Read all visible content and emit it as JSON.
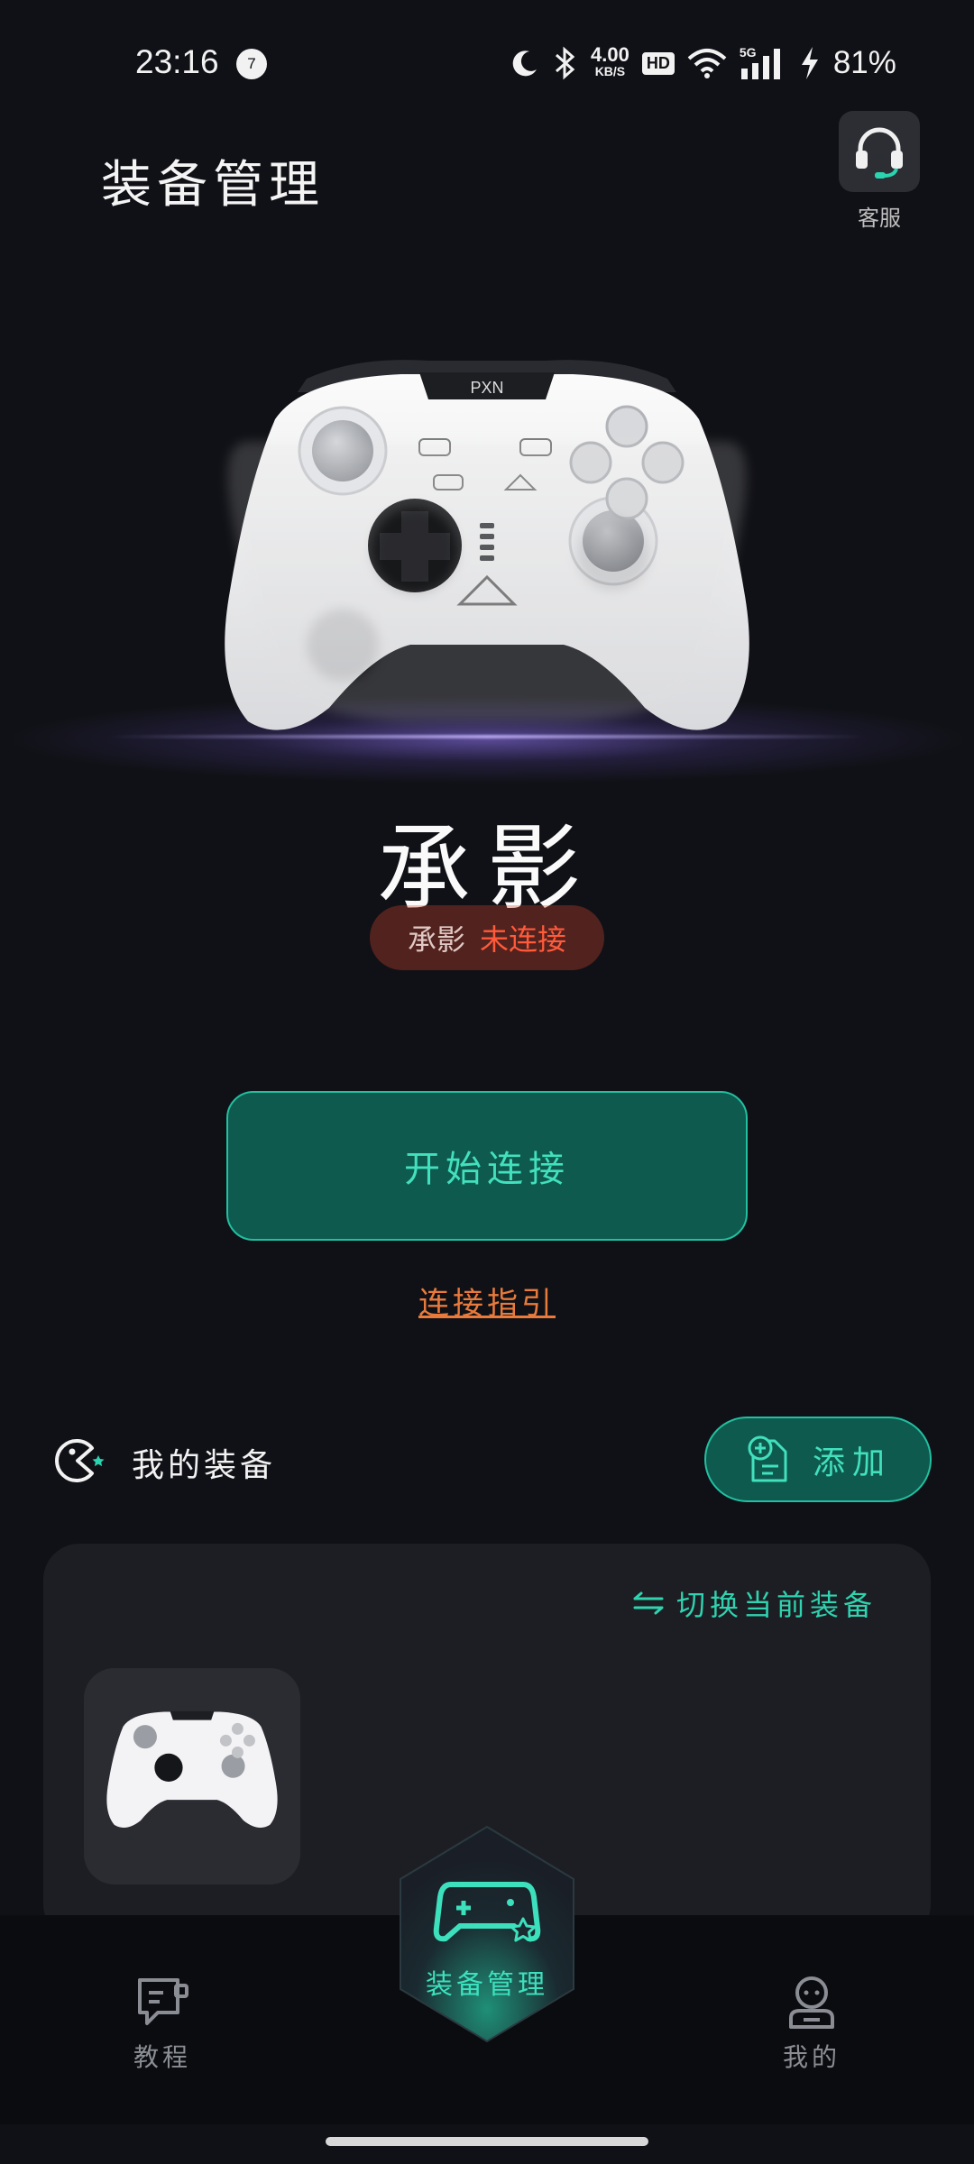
{
  "status_bar": {
    "time": "23:16",
    "notification_count": "7",
    "net_speed_value": "4.00",
    "net_speed_unit": "KB/S",
    "hd_label": "HD",
    "signal_label": "5G",
    "battery": "81%"
  },
  "header": {
    "title": "装备管理",
    "customer_service_label": "客服"
  },
  "hero": {
    "device_name": "承影",
    "status_device": "承影",
    "status_text": "未连接",
    "brand_label": "PXN"
  },
  "actions": {
    "connect_label": "开始连接",
    "guide_label": "连接指引"
  },
  "my_devices": {
    "title": "我的装备",
    "add_label": "添加",
    "switch_label": "切换当前装备"
  },
  "bottom_nav": {
    "items": [
      {
        "label": "教程"
      },
      {
        "label": "装备管理"
      },
      {
        "label": "我的"
      }
    ]
  },
  "colors": {
    "accent": "#42e0bd",
    "accent_bg": "#0e5a4e",
    "warning": "#ff5a3a",
    "link": "#e87a3c",
    "background": "#101116"
  }
}
